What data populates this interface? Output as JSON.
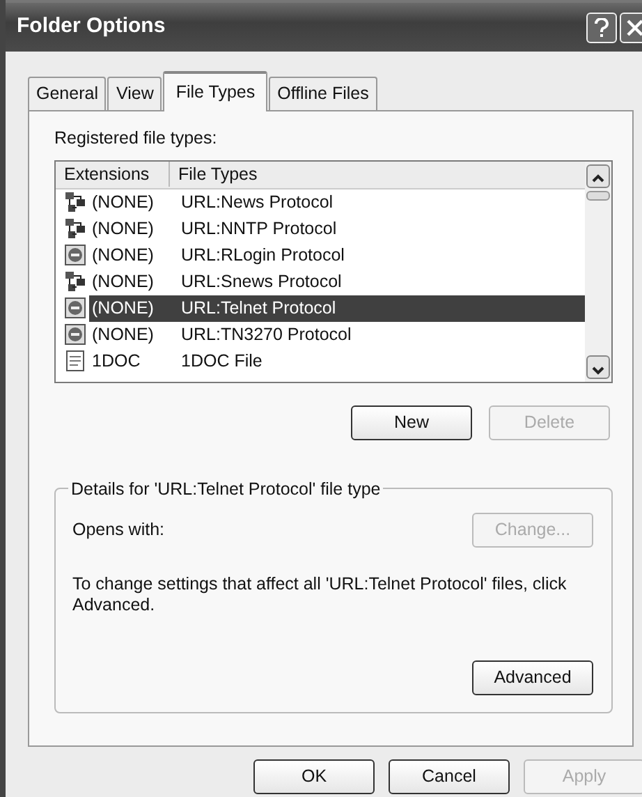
{
  "window": {
    "title": "Folder Options"
  },
  "tabs": [
    {
      "label": "General",
      "selected": false
    },
    {
      "label": "View",
      "selected": false
    },
    {
      "label": "File Types",
      "selected": true
    },
    {
      "label": "Offline Files",
      "selected": false
    }
  ],
  "registered_label": "Registered file types:",
  "list": {
    "columns": [
      "Extensions",
      "File Types"
    ],
    "rows": [
      {
        "kind": "network",
        "extension": "(NONE)",
        "file_type": "URL:News Protocol",
        "selected": false
      },
      {
        "kind": "network",
        "extension": "(NONE)",
        "file_type": "URL:NNTP Protocol",
        "selected": false
      },
      {
        "kind": "web",
        "extension": "(NONE)",
        "file_type": "URL:RLogin Protocol",
        "selected": false
      },
      {
        "kind": "network",
        "extension": "(NONE)",
        "file_type": "URL:Snews Protocol",
        "selected": false
      },
      {
        "kind": "web",
        "extension": "(NONE)",
        "file_type": "URL:Telnet Protocol",
        "selected": true
      },
      {
        "kind": "web",
        "extension": "(NONE)",
        "file_type": "URL:TN3270 Protocol",
        "selected": false
      },
      {
        "kind": "document",
        "extension": "1DOC",
        "file_type": "1DOC File",
        "selected": false
      }
    ]
  },
  "list_buttons": [
    {
      "label": "New",
      "disabled": false
    },
    {
      "label": "Delete",
      "disabled": true
    }
  ],
  "details": {
    "legend": "Details for 'URL:Telnet Protocol' file type",
    "opens_with": "Opens with:",
    "change_button": {
      "label": "Change...",
      "disabled": true
    },
    "note": "To change settings that affect all 'URL:Telnet Protocol' files, click Advanced.",
    "advanced_button": {
      "label": "Advanced",
      "disabled": false
    }
  },
  "buttons": [
    {
      "label": "OK",
      "disabled": false
    },
    {
      "label": "Cancel",
      "disabled": false
    },
    {
      "label": "Apply",
      "disabled": true
    }
  ]
}
